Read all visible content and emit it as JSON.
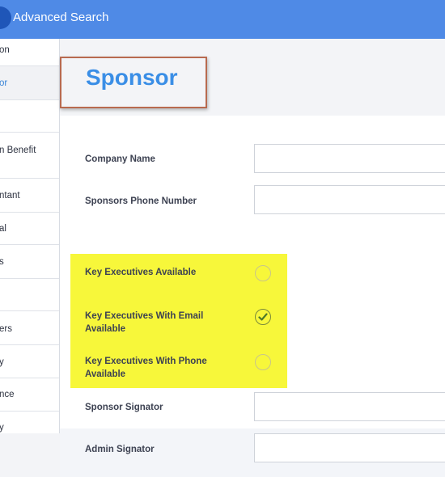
{
  "app": {
    "title": "Advanced Search"
  },
  "sidebar": {
    "items": [
      {
        "label": "on"
      },
      {
        "label": "or"
      },
      {
        "label": ""
      },
      {
        "label": "n Benefit"
      },
      {
        "label": "ntant"
      },
      {
        "label": "al"
      },
      {
        "label": "s"
      },
      {
        "label": ""
      },
      {
        "label": "ers"
      },
      {
        "label": "y"
      },
      {
        "label": "nce"
      },
      {
        "label": "y"
      }
    ]
  },
  "page": {
    "title": "Sponsor"
  },
  "form": {
    "company_name_label": "Company Name",
    "sponsors_phone_label": "Sponsors Phone Number",
    "key_exec_available_label": "Key Executives Available",
    "key_exec_email_label_line1": "Key Executives With Email",
    "key_exec_email_label_line2": "Available",
    "key_exec_phone_label_line1": "Key Executives With Phone",
    "key_exec_phone_label_line2": "Available",
    "sponsor_signator_label": "Sponsor Signator",
    "admin_signator_label": "Admin Signator",
    "company_name_value": "",
    "sponsors_phone_value": "",
    "sponsor_signator_value": "",
    "admin_signator_value": "",
    "key_exec_available_checked": false,
    "key_exec_email_checked": true,
    "key_exec_phone_checked": false
  },
  "colors": {
    "topbar": "#4f8ae6",
    "accent": "#3a8ee6",
    "highlight": "#f7f73a",
    "header_box_border": "#b86a4f"
  },
  "icons": {
    "logo": "app-logo-icon",
    "check": "check-icon"
  }
}
